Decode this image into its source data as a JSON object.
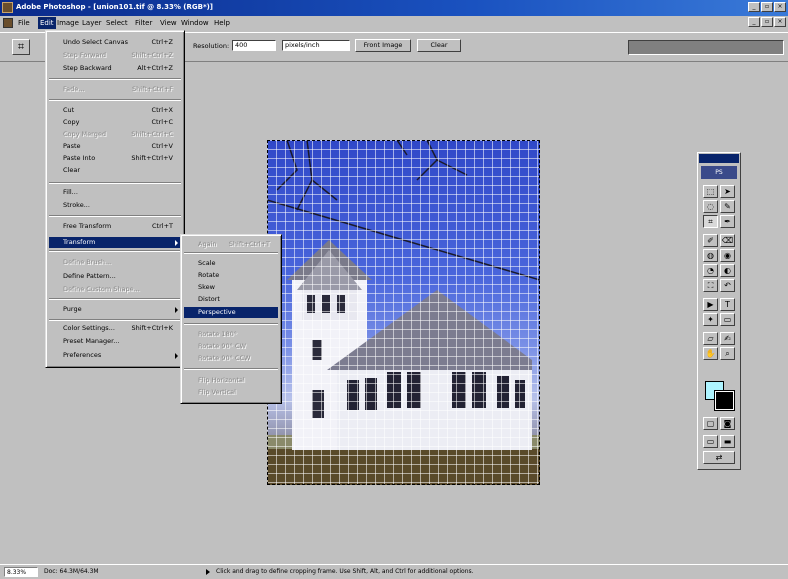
{
  "window": {
    "title": "Adobe Photoshop - [union101.tif @ 8.33% (RGB*)]"
  },
  "menubar": {
    "items": [
      "File",
      "Edit",
      "Image",
      "Layer",
      "Select",
      "Filter",
      "View",
      "Window",
      "Help"
    ]
  },
  "options": {
    "resolution_label": "Resolution:",
    "resolution_value": "400",
    "units_value": "pixels/inch",
    "front_image_label": "Front Image",
    "clear_label": "Clear"
  },
  "edit_menu": {
    "items": [
      {
        "label": "Undo Select Canvas",
        "shortcut": "Ctrl+Z",
        "disabled": false
      },
      {
        "label": "Step Forward",
        "shortcut": "Shift+Ctrl+Z",
        "disabled": true
      },
      {
        "label": "Step Backward",
        "shortcut": "Alt+Ctrl+Z",
        "disabled": false
      },
      {
        "label": "Fade...",
        "shortcut": "Shift+Ctrl+F",
        "disabled": true
      },
      {
        "label": "Cut",
        "shortcut": "Ctrl+X",
        "disabled": false
      },
      {
        "label": "Copy",
        "shortcut": "Ctrl+C",
        "disabled": false
      },
      {
        "label": "Copy Merged",
        "shortcut": "Shift+Ctrl+C",
        "disabled": true
      },
      {
        "label": "Paste",
        "shortcut": "Ctrl+V",
        "disabled": false
      },
      {
        "label": "Paste Into",
        "shortcut": "Shift+Ctrl+V",
        "disabled": false
      },
      {
        "label": "Clear",
        "shortcut": "",
        "disabled": false
      },
      {
        "label": "Fill...",
        "shortcut": "",
        "disabled": false
      },
      {
        "label": "Stroke...",
        "shortcut": "",
        "disabled": false
      },
      {
        "label": "Free Transform",
        "shortcut": "Ctrl+T",
        "disabled": false
      },
      {
        "label": "Transform",
        "shortcut": "",
        "disabled": false
      },
      {
        "label": "Define Brush...",
        "shortcut": "",
        "disabled": true
      },
      {
        "label": "Define Pattern...",
        "shortcut": "",
        "disabled": false
      },
      {
        "label": "Define Custom Shape...",
        "shortcut": "",
        "disabled": true
      },
      {
        "label": "Purge",
        "shortcut": "",
        "disabled": false
      },
      {
        "label": "Color Settings...",
        "shortcut": "Shift+Ctrl+K",
        "disabled": false
      },
      {
        "label": "Preset Manager...",
        "shortcut": "",
        "disabled": false
      },
      {
        "label": "Preferences",
        "shortcut": "",
        "disabled": false
      }
    ]
  },
  "transform_menu": {
    "items": [
      {
        "label": "Again",
        "shortcut": "Shift+Ctrl+T",
        "disabled": true
      },
      {
        "label": "Scale",
        "disabled": false
      },
      {
        "label": "Rotate",
        "disabled": false
      },
      {
        "label": "Skew",
        "disabled": false
      },
      {
        "label": "Distort",
        "disabled": false
      },
      {
        "label": "Perspective",
        "disabled": false
      },
      {
        "label": "Rotate 180°",
        "disabled": true
      },
      {
        "label": "Rotate 90° CW",
        "disabled": true
      },
      {
        "label": "Rotate 90° CCW",
        "disabled": true
      },
      {
        "label": "Flip Horizontal",
        "disabled": true
      },
      {
        "label": "Flip Vertical",
        "disabled": true
      }
    ]
  },
  "status": {
    "zoom": "8.33%",
    "doc_size": "Doc: 64.3M/64.3M",
    "hint": "Click and drag to define cropping frame. Use Shift, Alt, and Ctrl for additional options."
  }
}
